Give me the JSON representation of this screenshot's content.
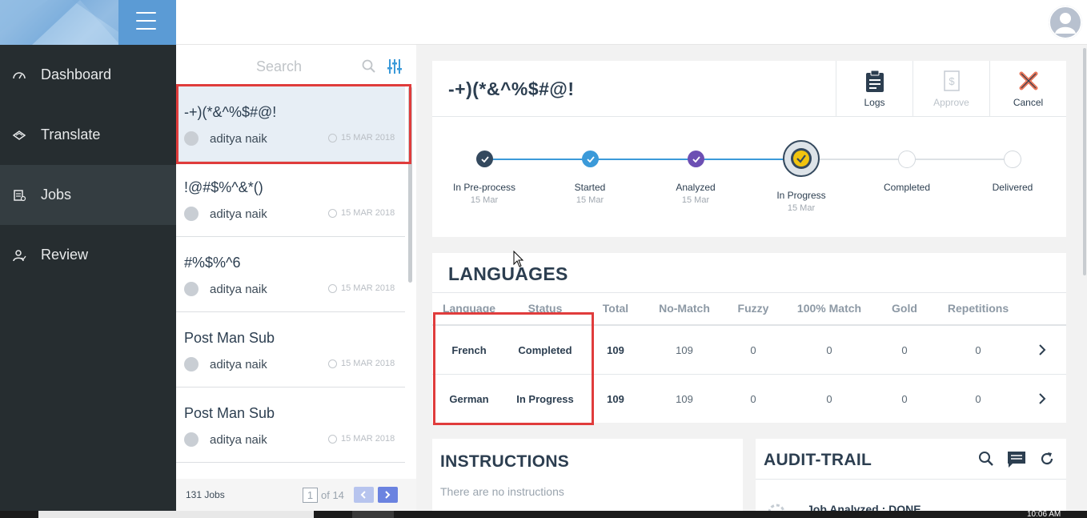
{
  "sidebar": {
    "items": [
      {
        "label": "Dashboard",
        "icon": "gauge-icon"
      },
      {
        "label": "Translate",
        "icon": "translate-icon"
      },
      {
        "label": "Jobs",
        "icon": "jobs-icon"
      },
      {
        "label": "Review",
        "icon": "review-icon"
      }
    ],
    "active": "Jobs"
  },
  "joblist": {
    "search_placeholder": "Search",
    "jobs": [
      {
        "title": "-+)(*&^%$#@!",
        "user": "aditya naik",
        "date": "15 MAR 2018"
      },
      {
        "title": "!@#$%^&*()",
        "user": "aditya naik",
        "date": "15 MAR 2018"
      },
      {
        "title": "#%$%^6",
        "user": "aditya naik",
        "date": "15 MAR 2018"
      },
      {
        "title": "Post Man Sub",
        "user": "aditya naik",
        "date": "15 MAR 2018"
      },
      {
        "title": "Post Man Sub",
        "user": "aditya naik",
        "date": "15 MAR 2018"
      }
    ],
    "count_label": "131 Jobs",
    "page": "1",
    "of_pages": "of 14"
  },
  "job": {
    "name": "-+)(*&^%$#@!",
    "actions": {
      "logs": "Logs",
      "approve": "Approve",
      "cancel": "Cancel"
    },
    "timeline": [
      {
        "label": "In Pre-process",
        "date": "15 Mar",
        "state": "done"
      },
      {
        "label": "Started",
        "date": "15 Mar",
        "state": "done"
      },
      {
        "label": "Analyzed",
        "date": "15 Mar",
        "state": "done"
      },
      {
        "label": "In Progress",
        "date": "15 Mar",
        "state": "current"
      },
      {
        "label": "Completed",
        "date": "",
        "state": "pending"
      },
      {
        "label": "Delivered",
        "date": "",
        "state": "pending"
      }
    ]
  },
  "languages": {
    "title": "LANGUAGES",
    "columns": [
      "Language",
      "Status",
      "Total",
      "No-Match",
      "Fuzzy",
      "100% Match",
      "Gold",
      "Repetitions"
    ],
    "rows": [
      {
        "language": "French",
        "status": "Completed",
        "total": "109",
        "no_match": "109",
        "fuzzy": "0",
        "match100": "0",
        "gold": "0",
        "repetitions": "0"
      },
      {
        "language": "German",
        "status": "In Progress",
        "total": "109",
        "no_match": "109",
        "fuzzy": "0",
        "match100": "0",
        "gold": "0",
        "repetitions": "0"
      }
    ]
  },
  "instructions": {
    "title": "INSTRUCTIONS",
    "empty_text": "There are no instructions"
  },
  "audit": {
    "title": "AUDIT-TRAIL",
    "first_entry": "Job Analyzed : DONE"
  },
  "taskbar": {
    "time": "10:06 AM"
  },
  "colors": {
    "sidebar_bg": "#262d30",
    "accent_blue": "#3b9ad9",
    "dark_navy": "#34495e",
    "purple": "#6c4fb3",
    "current_yellow": "#f1c40f",
    "highlight_red": "#e03c3c",
    "pager_blue": "#6b83e0"
  }
}
